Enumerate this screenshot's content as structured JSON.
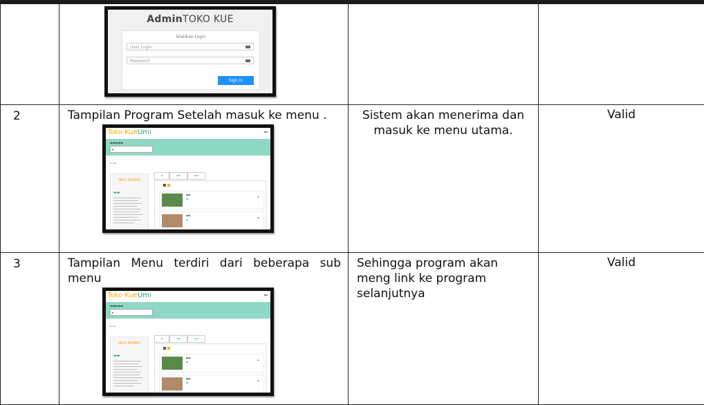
{
  "login_thumb": {
    "title_bold": "Admin",
    "title_rest": "TOKO KUE",
    "subtitle": "Silahkan Login",
    "user_placeholder": "User Login",
    "password_placeholder": "Password",
    "signin_label": "Sign In"
  },
  "rows": [
    {
      "no": "2",
      "description": "Tampilan Program Setelah masuk ke menu .",
      "result": "Sistem akan menerima dan masuk ke menu utama.",
      "status": "Valid"
    },
    {
      "no": "3",
      "description": "Tampilan Menu terdiri dari beberapa sub menu",
      "result": "Sehingga program akan meng link ke program selanjutnya",
      "status": "Valid"
    }
  ],
  "app_thumb": {
    "brand_a": "Toko Kue",
    "brand_b": "Umi",
    "side_title": "INFO PROMO"
  },
  "colors": {
    "brand_yellow": "#f4b400",
    "brand_green": "#16a085",
    "hero_teal": "#8fd8c4",
    "signin_blue": "#1e90ff"
  }
}
